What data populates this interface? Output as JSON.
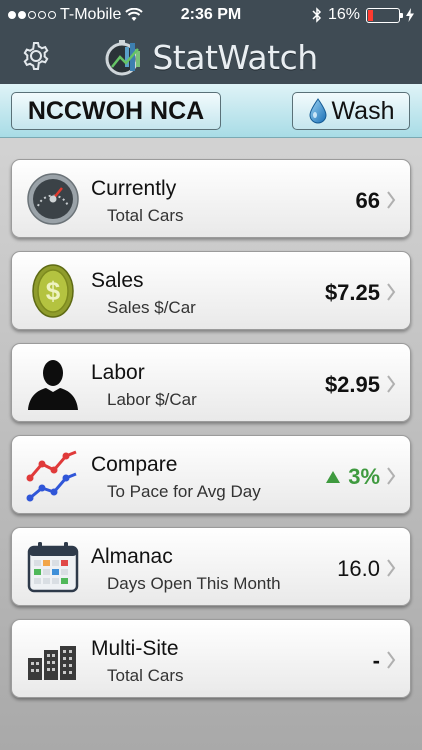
{
  "status_bar": {
    "carrier": "T-Mobile",
    "time": "2:36 PM",
    "battery": "16%",
    "battery_level": 0.16,
    "signal_bars": 2,
    "signal_total": 5
  },
  "header": {
    "logo_text": "StatWatch"
  },
  "location_bar": {
    "site_name": "NCCWOH NCA",
    "wash_label": "Wash"
  },
  "cards": [
    {
      "title": "Currently",
      "subtitle": "Total Cars",
      "value": "66",
      "icon": "speedometer-icon"
    },
    {
      "title": "Sales",
      "subtitle": "Sales $/Car",
      "value": "$7.25",
      "icon": "dollar-coin-icon"
    },
    {
      "title": "Labor",
      "subtitle": "Labor $/Car",
      "value": "$2.95",
      "icon": "person-silhouette-icon"
    },
    {
      "title": "Compare",
      "subtitle": "To Pace for Avg Day",
      "value": "3%",
      "icon": "trend-lines-icon",
      "trend": "up",
      "trend_color": "#3f9a3f"
    },
    {
      "title": "Almanac",
      "subtitle": "Days Open This Month",
      "value": "16.0",
      "icon": "calendar-icon"
    },
    {
      "title": "Multi-Site",
      "subtitle": "Total Cars",
      "value": "-",
      "icon": "buildings-icon"
    }
  ],
  "colors": {
    "header_bg": "#3f4b54",
    "location_bar_bg": "#bfe6ee",
    "positive": "#3f9a3f",
    "battery_low": "#ff3b30"
  }
}
